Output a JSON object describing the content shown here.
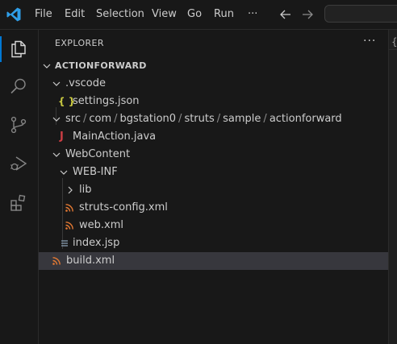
{
  "menu": {
    "file": "File",
    "edit": "Edit",
    "selection": "Selection",
    "view": "View",
    "go": "Go",
    "run": "Run",
    "more": "···"
  },
  "explorer": {
    "title": "EXPLORER",
    "more": "···",
    "root": "ACTIONFORWARD"
  },
  "tree": {
    "vscode": ".vscode",
    "settings": "settings.json",
    "src_path": [
      "src",
      "com",
      "bgstation0",
      "struts",
      "sample",
      "actionforward"
    ],
    "mainaction": "MainAction.java",
    "webcontent": "WebContent",
    "webinf": "WEB-INF",
    "lib": "lib",
    "struts_config": "struts-config.xml",
    "web_xml": "web.xml",
    "index_jsp": "index.jsp",
    "build_xml": "build.xml"
  },
  "editor": {
    "peek": "{"
  },
  "colors": {
    "accent": "#0078d4",
    "json_icon": "#cbcb41",
    "java_icon": "#cc3e44",
    "xml_icon": "#e37933",
    "selected_row": "#37373d"
  },
  "icons": {
    "explorer": "files-icon",
    "search": "search-icon",
    "scm": "source-control-icon",
    "debug": "run-debug-icon",
    "extensions": "extensions-icon"
  }
}
